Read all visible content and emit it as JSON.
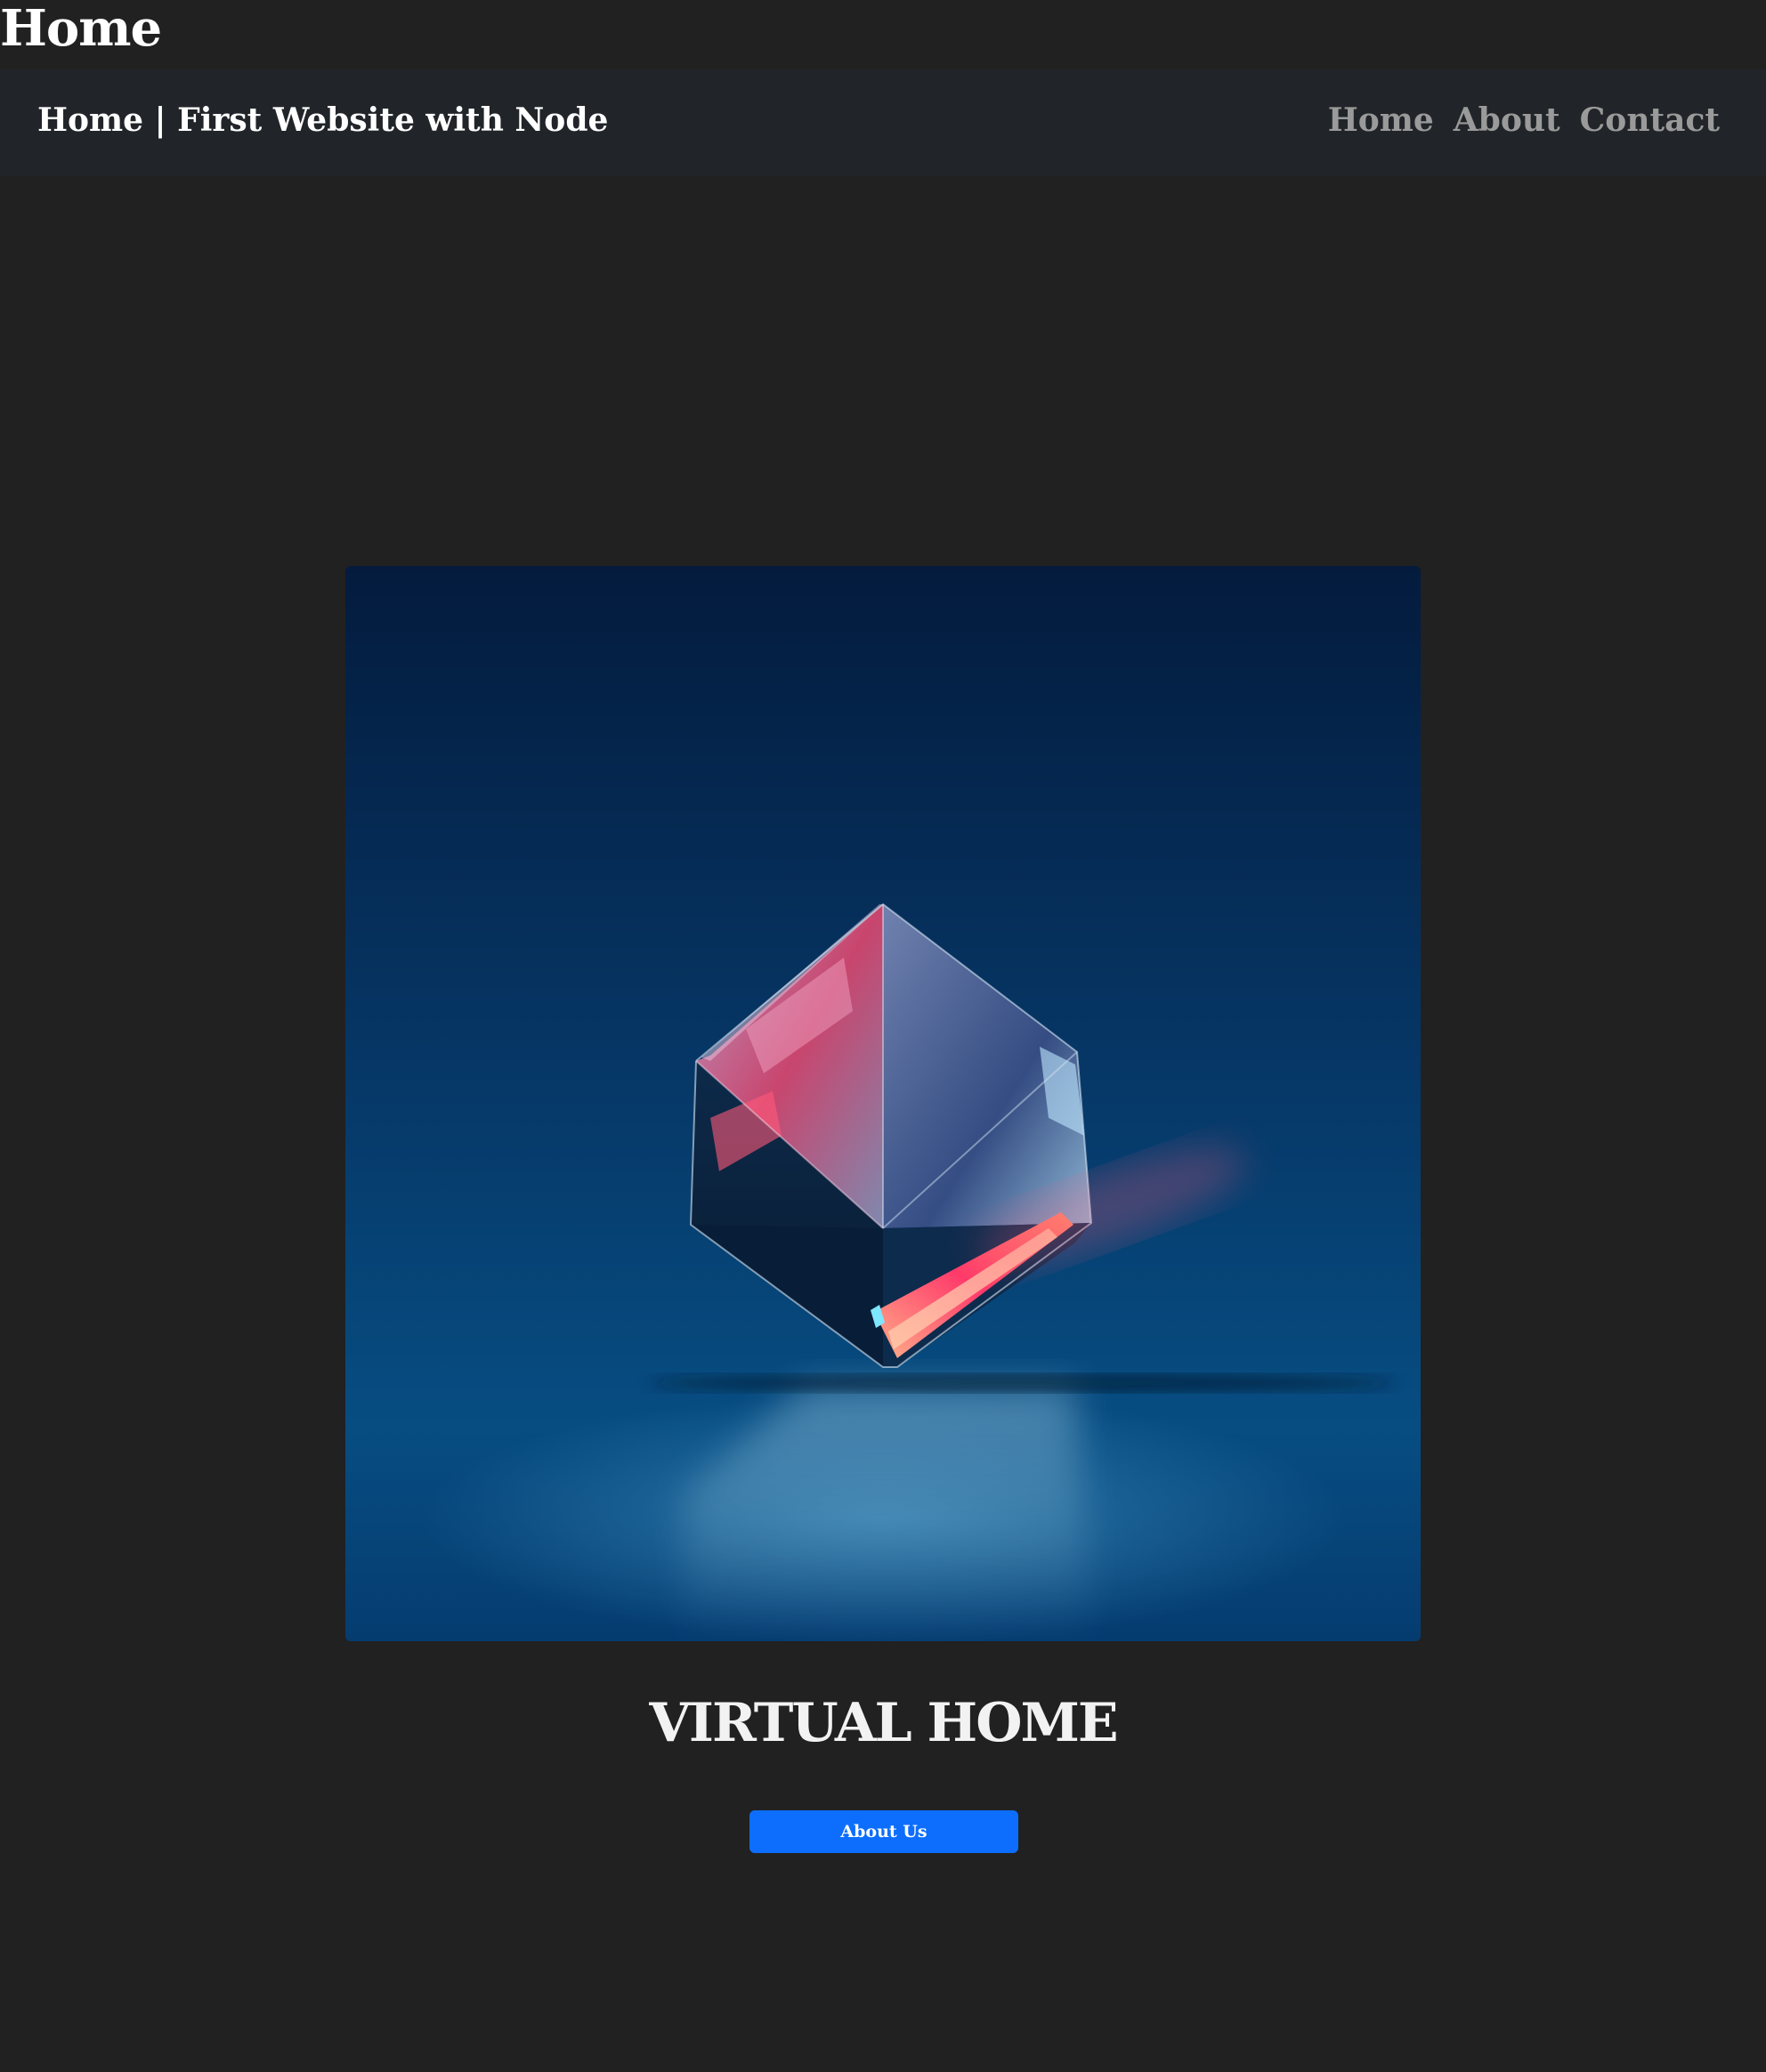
{
  "page": {
    "heading": "Home"
  },
  "navbar": {
    "brand": "Home | First Website with Node",
    "links": [
      {
        "label": "Home"
      },
      {
        "label": "About"
      },
      {
        "label": "Contact"
      }
    ]
  },
  "hero": {
    "image_subject": "glowing-crystal-cube",
    "title": "VIRTUAL HOME",
    "button_label": "About Us"
  },
  "colors": {
    "background": "#212121",
    "navbar": "#212529",
    "nav_link": "#9a9a9a",
    "button": "#0d6efd"
  }
}
